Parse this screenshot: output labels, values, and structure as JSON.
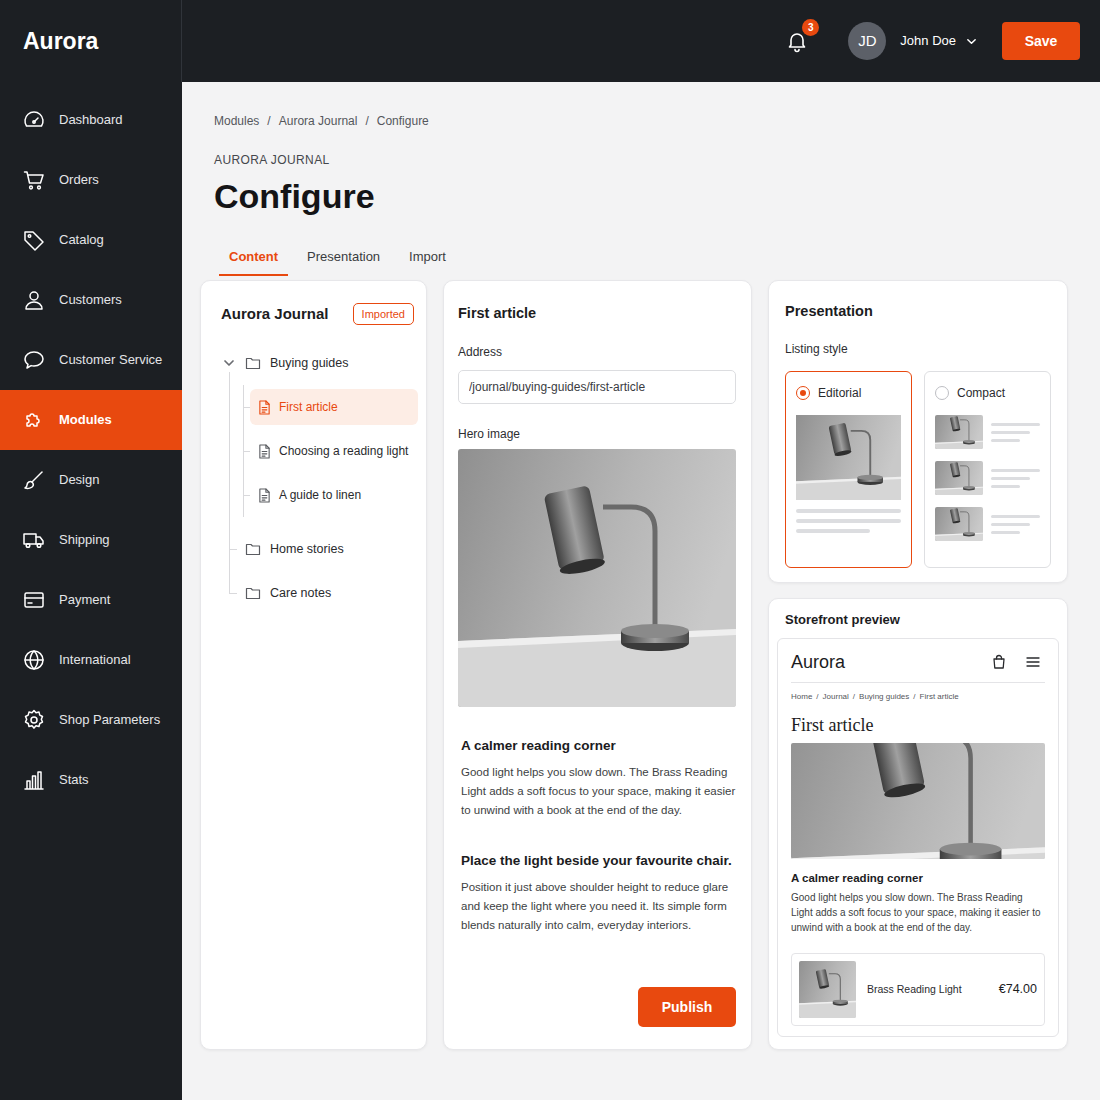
{
  "app": {
    "logo": "Aurora"
  },
  "topbar": {
    "notifications": "3",
    "user": {
      "initials": "JD",
      "name": "John Doe"
    },
    "save": "Save"
  },
  "sidebar": {
    "items": [
      {
        "label": "Dashboard",
        "selected": false
      },
      {
        "label": "Orders",
        "selected": false
      },
      {
        "label": "Catalog",
        "selected": false
      },
      {
        "label": "Customers",
        "selected": false
      },
      {
        "label": "Customer Service",
        "selected": false
      },
      {
        "label": "Modules",
        "selected": true
      },
      {
        "label": "Design",
        "selected": false
      },
      {
        "label": "Shipping",
        "selected": false
      },
      {
        "label": "Payment",
        "selected": false
      },
      {
        "label": "International",
        "selected": false
      },
      {
        "label": "Shop Parameters",
        "selected": false
      },
      {
        "label": "Stats",
        "selected": false
      }
    ]
  },
  "breadcrumb": {
    "separator": "/",
    "items": [
      "Modules",
      "Aurora Journal",
      "Configure"
    ]
  },
  "eyebrow": "AURORA JOURNAL",
  "title": "Configure",
  "tabs": [
    {
      "label": "Content",
      "selected": true
    },
    {
      "label": "Presentation",
      "selected": false
    },
    {
      "label": "Import",
      "selected": false
    }
  ],
  "tree": {
    "title": "Aurora Journal",
    "badge": "Imported",
    "nodes": [
      {
        "label": "Buying guides",
        "kind": "folder",
        "expanded": true,
        "selected": false,
        "children": [
          {
            "label": "First article",
            "kind": "page",
            "selected": true
          },
          {
            "label": "Choosing a reading light",
            "kind": "page",
            "selected": false
          },
          {
            "label": "A guide to linen",
            "kind": "page",
            "selected": false
          }
        ]
      },
      {
        "label": "Home stories",
        "kind": "folder",
        "expanded": false,
        "selected": false,
        "children": []
      },
      {
        "label": "Care notes",
        "kind": "folder",
        "expanded": false,
        "selected": false,
        "children": []
      }
    ]
  },
  "editor": {
    "title": "First article",
    "address_label": "Address",
    "address": "/journal/buying-guides/first-article",
    "hero_label": "Hero image",
    "sections": [
      {
        "heading": "A calmer reading corner",
        "body": "Good light helps you slow down. The Brass Reading Light adds a soft focus to your space, making it easier to unwind with a book at the end of the day."
      },
      {
        "heading": "Place the light beside your favourite chair.",
        "body": "Position it just above shoulder height to reduce glare and keep the light where you need it. Its simple form blends naturally into calm, everyday interiors."
      }
    ],
    "publish": "Publish"
  },
  "presentation": {
    "title": "Presentation",
    "listing_label": "Listing style",
    "options": [
      {
        "label": "Editorial",
        "kind": "editorial",
        "selected": true
      },
      {
        "label": "Compact",
        "kind": "compact",
        "selected": false
      }
    ]
  },
  "preview": {
    "title": "Storefront preview",
    "logo": "Aurora",
    "breadcrumb": {
      "separator": "/",
      "items": [
        "Home",
        "Journal",
        "Buying guides",
        "First article"
      ]
    },
    "article_title": "First article",
    "heading": "A calmer reading corner",
    "body": "Good light helps you slow down. The Brass Reading Light adds a soft focus to your space, making it easier to unwind with a book at the end of the day.",
    "product": {
      "name": "Brass Reading Light",
      "price": "€74.00"
    }
  }
}
